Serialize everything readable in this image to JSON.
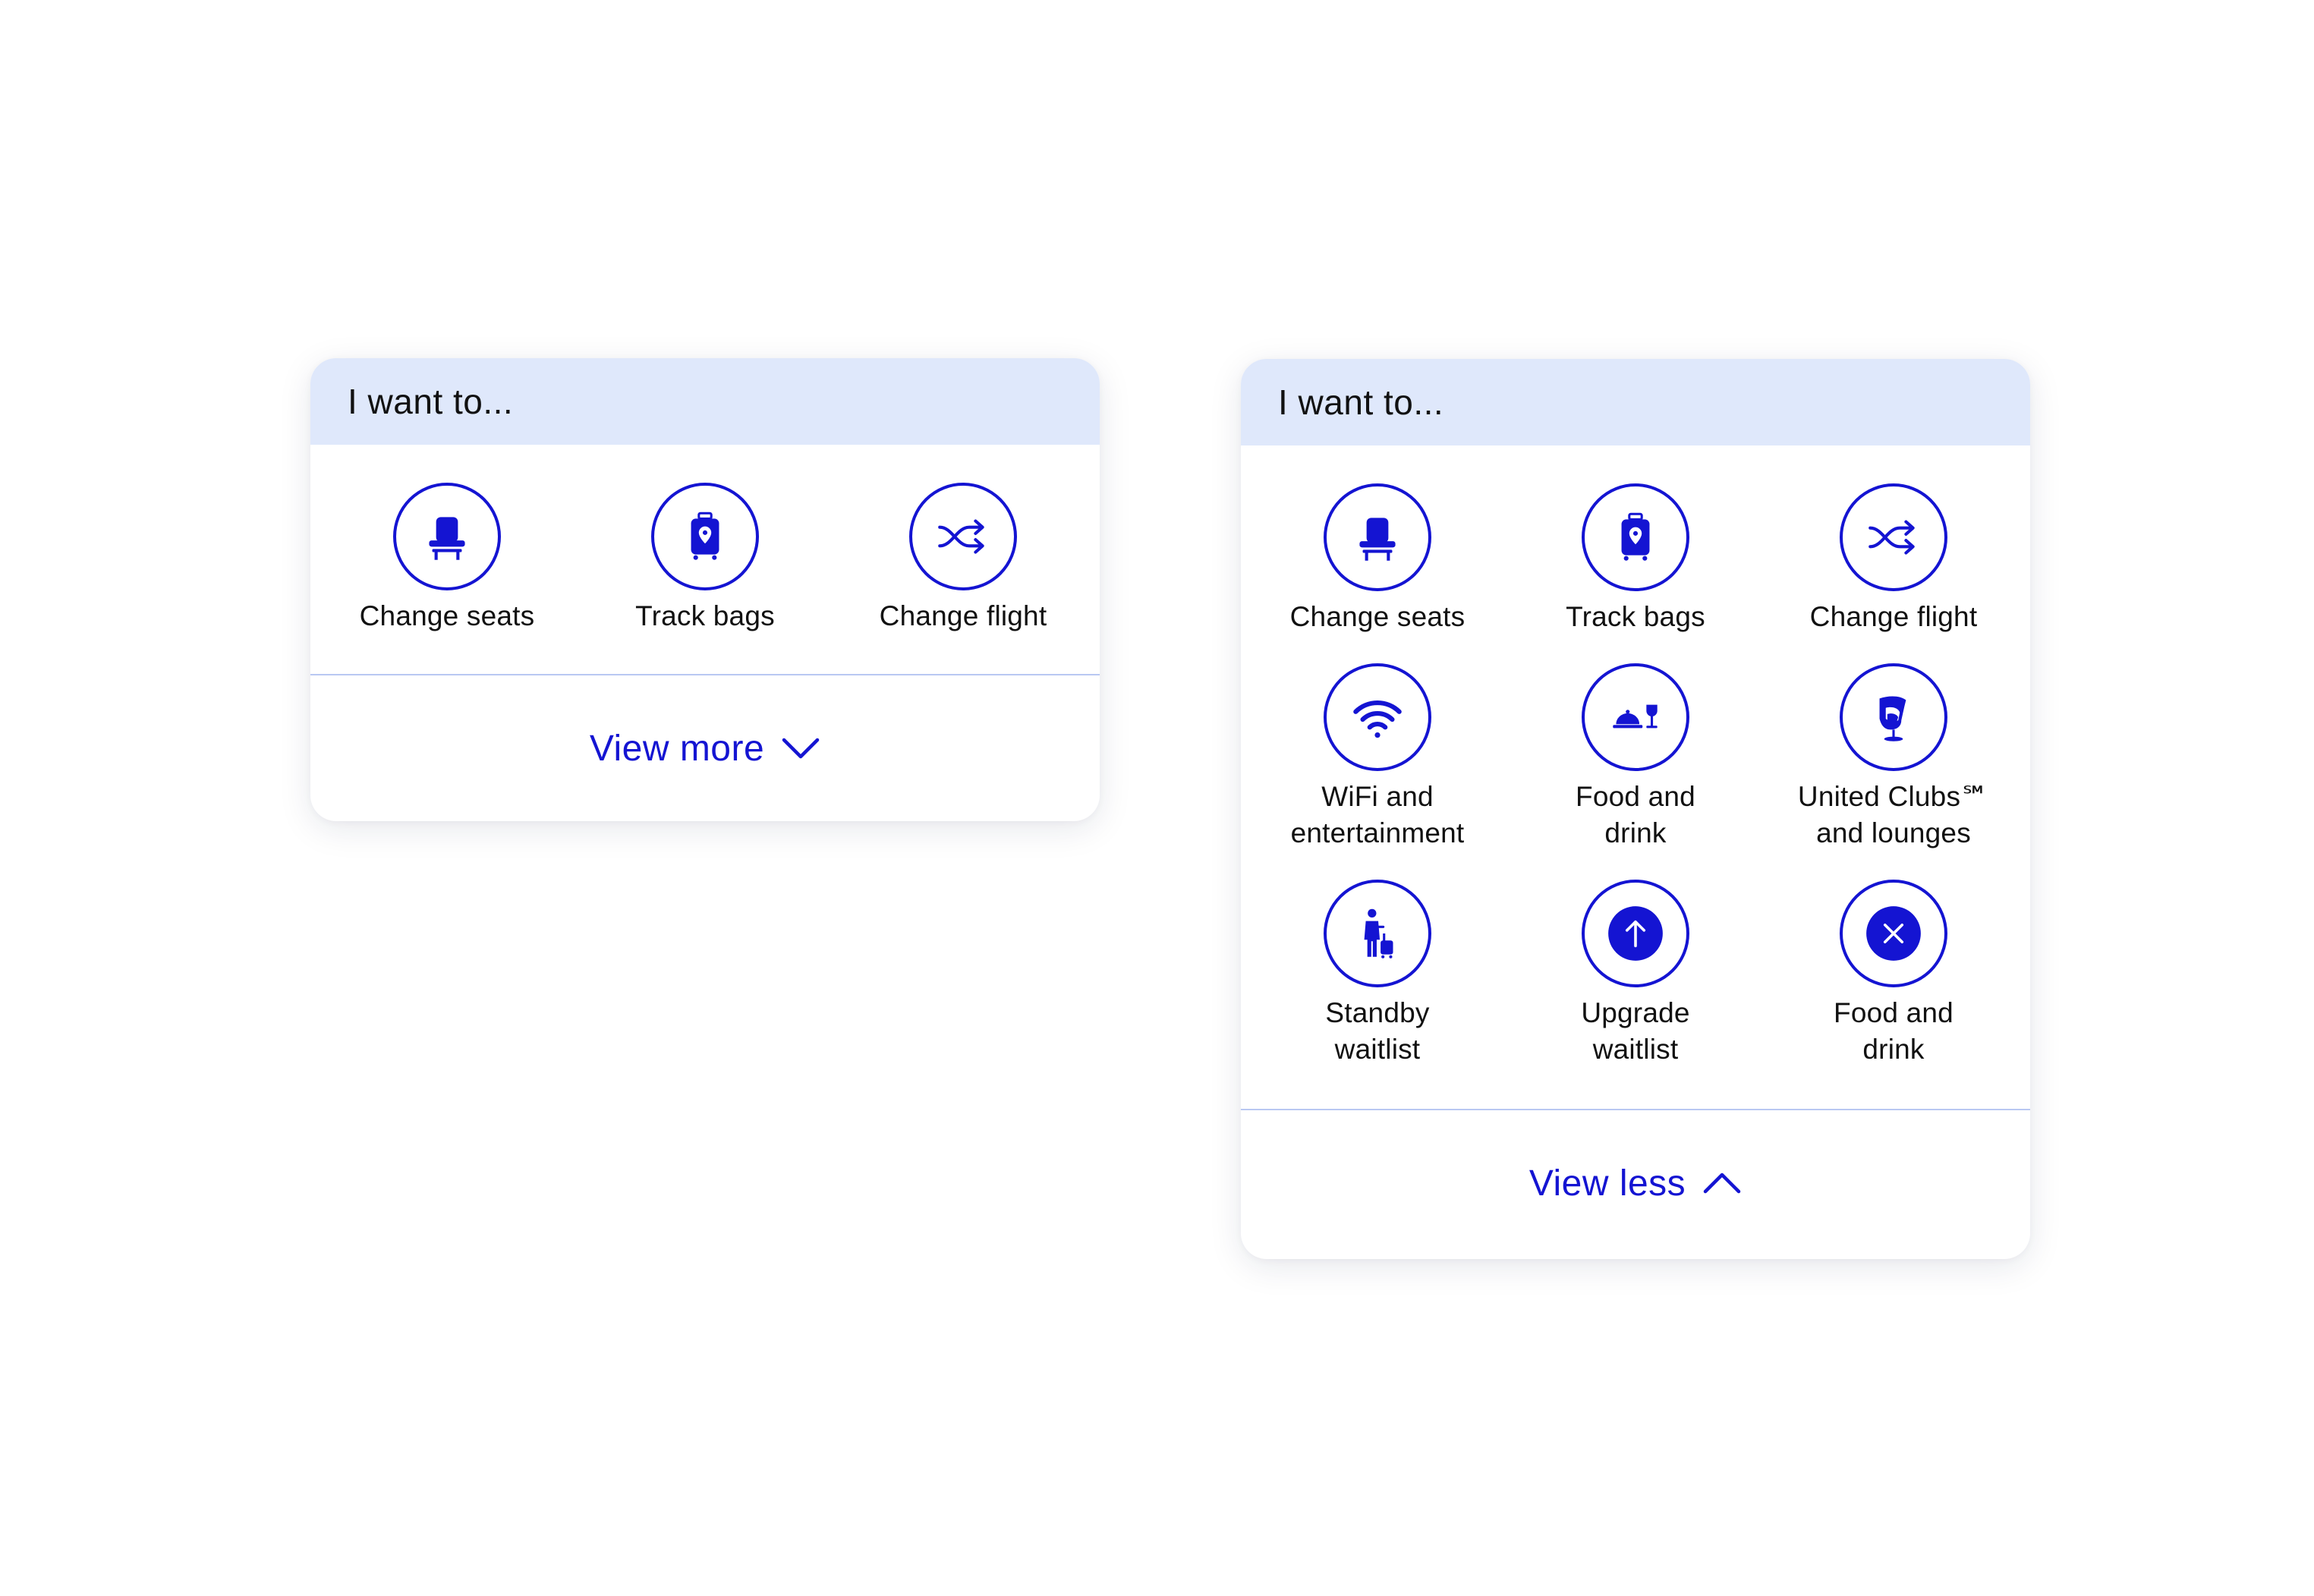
{
  "colors": {
    "accent": "#1414d2",
    "header_bg": "#dfe8fb",
    "text": "#111111",
    "divider": "#b9c8f2"
  },
  "collapsed": {
    "title": "I want to...",
    "items": [
      {
        "label": "Change seats",
        "icon": "seat-icon"
      },
      {
        "label": "Track bags",
        "icon": "luggage-location-icon"
      },
      {
        "label": "Change flight",
        "icon": "shuffle-icon"
      }
    ],
    "toggle_label": "View more",
    "toggle_icon": "chevron-down-icon"
  },
  "expanded": {
    "title": "I want to...",
    "items": [
      {
        "label": "Change seats",
        "icon": "seat-icon"
      },
      {
        "label": "Track bags",
        "icon": "luggage-location-icon"
      },
      {
        "label": "Change flight",
        "icon": "shuffle-icon"
      },
      {
        "label": "WiFi and\nentertainment",
        "icon": "wifi-icon"
      },
      {
        "label": "Food and\ndrink",
        "icon": "food-drink-icon"
      },
      {
        "label": "United Clubs℠\nand lounges",
        "icon": "lounge-chair-icon"
      },
      {
        "label": "Standby\nwaitlist",
        "icon": "traveler-luggage-icon"
      },
      {
        "label": "Upgrade\nwaitlist",
        "icon": "arrow-up-circle-icon"
      },
      {
        "label": "Food and\ndrink",
        "icon": "close-circle-icon"
      }
    ],
    "toggle_label": "View less",
    "toggle_icon": "chevron-up-icon"
  }
}
